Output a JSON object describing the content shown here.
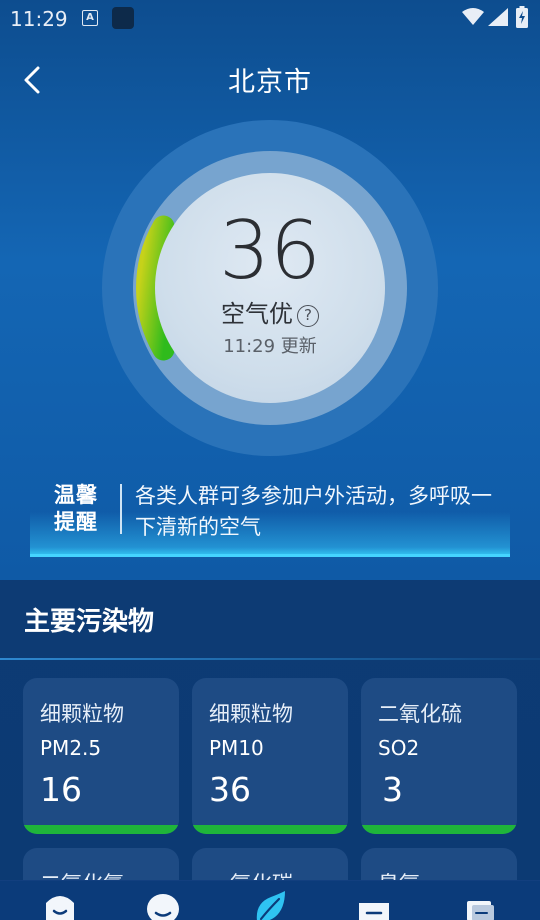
{
  "status_bar": {
    "time": "11:29"
  },
  "header": {
    "title": "北京市"
  },
  "aqi": {
    "value": "36",
    "level": "空气优",
    "update_time": "11:29 更新",
    "gauge_fill_fraction": 0.1,
    "gauge_color": "#6ccd1e"
  },
  "tip": {
    "title_line1": "温馨",
    "title_line2": "提醒",
    "text": "各类人群可多参加户外活动，多呼吸一下清新的空气"
  },
  "pollutants": {
    "title": "主要污染物",
    "items": [
      {
        "name": "细颗粒物",
        "code": "PM2.5",
        "value": "16"
      },
      {
        "name": "细颗粒物",
        "code": "PM10",
        "value": "36"
      },
      {
        "name": "二氧化硫",
        "code": "SO2",
        "value": "3"
      }
    ],
    "partial_items": [
      {
        "name": "二氧化氮"
      },
      {
        "name": "一氧化碳"
      },
      {
        "name": "臭氧"
      }
    ],
    "bar_color": "#1fb53a"
  },
  "bottom_nav": [
    "home-icon",
    "chat-icon",
    "leaf-icon",
    "message-icon",
    "book-icon"
  ]
}
